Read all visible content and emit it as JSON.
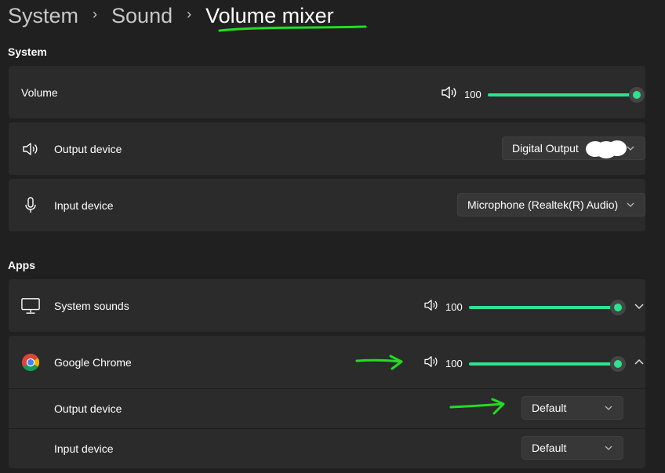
{
  "breadcrumb": {
    "items": [
      "System",
      "Sound",
      "Volume mixer"
    ]
  },
  "system_section": {
    "heading": "System",
    "volume": {
      "label": "Volume",
      "value": "100",
      "level": 1.0
    },
    "output_device": {
      "label": "Output device",
      "selected": "Digital Output"
    },
    "input_device": {
      "label": "Input device",
      "selected": "Microphone (Realtek(R) Audio)"
    }
  },
  "apps_section": {
    "heading": "Apps",
    "apps": [
      {
        "name": "System sounds",
        "volume": "100",
        "level": 1.0,
        "expanded": false
      },
      {
        "name": "Google Chrome",
        "volume": "100",
        "level": 1.0,
        "expanded": true,
        "output_device": {
          "label": "Output device",
          "selected": "Default"
        },
        "input_device": {
          "label": "Input device",
          "selected": "Default"
        }
      }
    ]
  },
  "colors": {
    "accent": "#2de38d",
    "background": "#202020",
    "card": "#2b2b2b",
    "annotation": "#22dd22"
  },
  "icons": {
    "speaker": "speaker-icon",
    "microphone": "microphone-icon",
    "monitor": "monitor-icon",
    "chrome": "chrome-logo-icon"
  }
}
